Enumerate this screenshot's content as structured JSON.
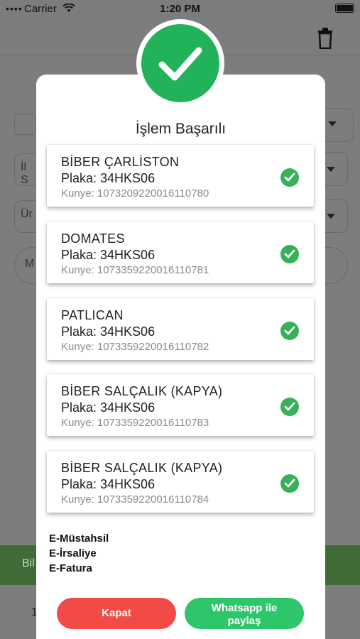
{
  "status_bar": {
    "carrier": "Carrier",
    "time": "1:20 PM"
  },
  "background": {
    "field_1": "İl S",
    "field_2": "Ür",
    "field_3": "M",
    "green_bar": "Bil",
    "bottom_left": "1"
  },
  "modal": {
    "title": "İşlem Başarılı",
    "items": [
      {
        "name": "BİBER ÇARLİSTON",
        "plate": "Plaka: 34HKS06",
        "kunye": "Kunye: 1073209220016110780"
      },
      {
        "name": "DOMATES",
        "plate": "Plaka: 34HKS06",
        "kunye": "Kunye: 1073359220016110781"
      },
      {
        "name": "PATLICAN",
        "plate": "Plaka: 34HKS06",
        "kunye": "Kunye: 1073359220016110782"
      },
      {
        "name": "BİBER SALÇALIK (KAPYA)",
        "plate": "Plaka: 34HKS06",
        "kunye": "Kunye: 1073359220016110783"
      },
      {
        "name": "BİBER SALÇALIK (KAPYA)",
        "plate": "Plaka: 34HKS06",
        "kunye": "Kunye: 1073359220016110784"
      }
    ],
    "documents": [
      "E-Müstahsil",
      "E-İrsaliye",
      "E-Fatura"
    ],
    "close_label": "Kapat",
    "share_label_line1": "Whatsapp ile",
    "share_label_line2": "paylaş"
  },
  "colors": {
    "success_green": "#22b35a",
    "check_green": "#35b257",
    "close_red": "#f24a46",
    "share_green": "#2ec66b"
  },
  "icons": [
    "wifi-icon",
    "battery-icon",
    "trash-icon",
    "success-check-icon",
    "item-check-icon",
    "dropdown-arrow-icon"
  ]
}
